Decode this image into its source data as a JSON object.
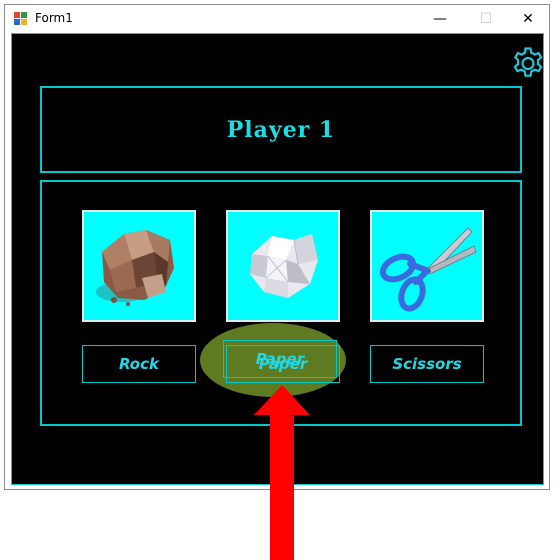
{
  "window": {
    "title": "Form1",
    "minimize_glyph": "—",
    "maximize_glyph": "☐",
    "close_glyph": "✕"
  },
  "player": {
    "title": "Player 1"
  },
  "choices": [
    {
      "label": "Rock",
      "icon": "rock-icon"
    },
    {
      "label": "Paper",
      "icon": "paper-icon"
    },
    {
      "label": "Scissors",
      "icon": "scissors-icon"
    }
  ],
  "settings": {
    "icon": "gear-icon"
  },
  "annotation": {
    "highlight_color": "#6e9128",
    "arrow_color": "#ff0000",
    "target": "Paper"
  },
  "colors": {
    "accent": "#00c9cc",
    "tile_bg": "#00ffff",
    "client_bg": "#000000"
  }
}
